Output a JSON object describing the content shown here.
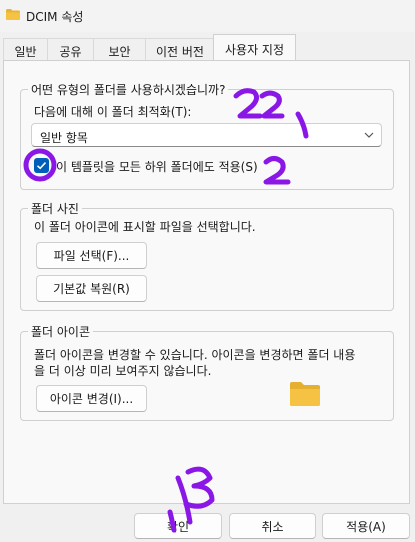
{
  "window": {
    "title": "DCIM 속성"
  },
  "tabs": [
    {
      "label": "일반"
    },
    {
      "label": "공유"
    },
    {
      "label": "보안"
    },
    {
      "label": "이전 버전"
    },
    {
      "label": "사용자 지정",
      "active": true
    }
  ],
  "optimize_group": {
    "legend": "어떤 유형의 폴더를 사용하시겠습니까?",
    "label": "다음에 대해 이 폴더 최적화(T):",
    "select_value": "일반 항목",
    "checkbox_label": "이 템플릿을 모든 하위 폴더에도 적용(S)",
    "checkbox_checked": true
  },
  "pictures_group": {
    "legend": "폴더 사진",
    "description": "이 폴더 아이콘에 표시할 파일을 선택합니다.",
    "choose_file_button": "파일 선택(F)...",
    "restore_default_button": "기본값 복원(R)"
  },
  "icon_group": {
    "legend": "폴더 아이콘",
    "description_line1": "폴더 아이콘을 변경할 수 있습니다. 아이콘을 변경하면 폴더 내용",
    "description_line2": "을 더 이상 미리 보여주지 않습니다.",
    "change_icon_button": "아이콘 변경(I)..."
  },
  "footer": {
    "ok_button": "확인",
    "cancel_button": "취소",
    "apply_button": "적용(A)"
  },
  "colors": {
    "accent": "#005fb8",
    "annotation_purple": "#8a17e6",
    "folder_yellow": "#f6c244"
  },
  "icons": {
    "title": "folder-icon",
    "select": "chevron-down-icon",
    "checkbox": "checkmark-icon",
    "preview": "folder-icon"
  }
}
